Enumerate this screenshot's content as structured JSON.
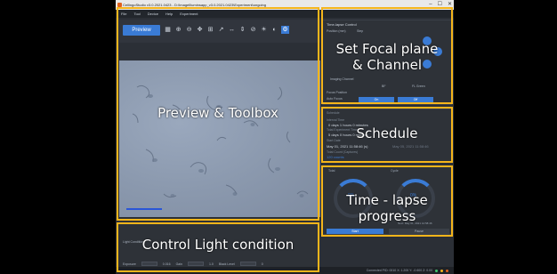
{
  "window": {
    "title": "CellingoStudio v3.0.2021.0423 - D:\\ImageIlluminsapp_v3.0.2021.0423\\Experiment\\ongoing",
    "controls": [
      "–",
      "☐",
      "✕"
    ]
  },
  "menubar": [
    "File",
    "Tool",
    "Device",
    "Help",
    "Experiment"
  ],
  "toolbar": {
    "preview_label": "Preview",
    "tools": [
      "▦",
      "⊕",
      "⊖",
      "✥",
      "⊞",
      "↗",
      "↔",
      "⇕",
      "⊘",
      "☀",
      "◐",
      "⚙"
    ]
  },
  "time_lapse_control": {
    "title": "Time-lapse Control",
    "position_label": "Position (mm)",
    "step_label": "Step",
    "imaging_channel_label": "Imaging Channel",
    "bf_label": "BF",
    "fl_label": "FL Green",
    "focus_position_label": "Focus Position",
    "auto_focus_label": "Auto Focus",
    "on_label": "On",
    "off_label": "Off"
  },
  "schedule": {
    "header": "Schedule",
    "interval_label": "Interval Time",
    "interval_value": "0 days 1 hours 0 minutes",
    "total_label": "Total Experiment Time",
    "total_value": "5 days 0 hours 0 minutes",
    "start_label": "Start Date",
    "start_value": "May 01, 2021 11:58:46 (s)",
    "finish_value": "May 05, 2021 11:58:46",
    "total_count_label": "Total Count (Captures)",
    "total_count_value": "120 counts"
  },
  "progress": {
    "total_label": "Total",
    "cycle_label": "Cycle",
    "total_percent": "0%",
    "cycle_percent": "0%",
    "total_fraction": 0.0,
    "cycle_fraction": 0.0,
    "start_label": "Start",
    "pause_label": "Pause",
    "next_label": "Next: May 01, 2021 12:58:46"
  },
  "light_control": {
    "label": "Light Condition",
    "exposure_label": "Exposure",
    "exposure_value": "0.016",
    "gain_label": "Gain",
    "gain_value": "1.0",
    "black_level_label": "Black Level",
    "black_level_value": "0"
  },
  "statusbar": {
    "text": "Connected  PID: 0010  X: 1.200  Y: -0.600  Z: 0.00"
  },
  "annotations": {
    "preview_toolbox": "Preview & Toolbox",
    "control_light": "Control Light condition",
    "focal_line1": "Set Focal plane",
    "focal_line2": "& Channel",
    "schedule": "Schedule",
    "progress_line1": "Time - lapse",
    "progress_line2": "progress"
  },
  "colors": {
    "accent": "#3a7bd5",
    "annotation_border": "#f5b51b",
    "panel_bg": "#2e3238"
  }
}
